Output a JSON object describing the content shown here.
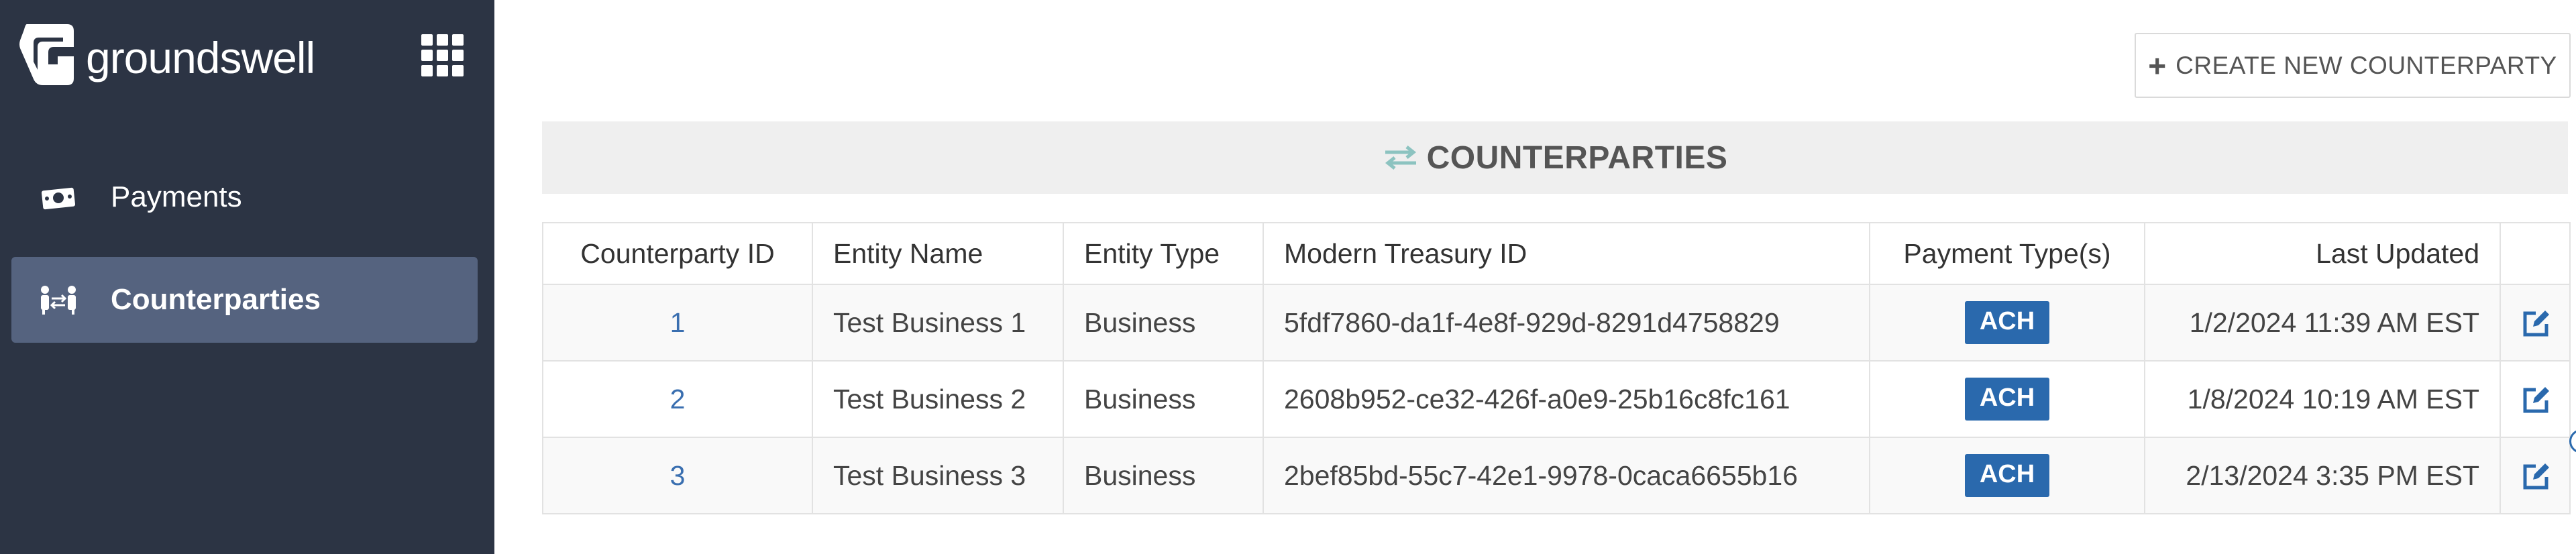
{
  "brand": {
    "name": "groundswell",
    "logo_icon": "groundswell-logo-icon",
    "apps_icon": "grid-apps-icon"
  },
  "nav": [
    {
      "label": "Payments",
      "icon": "money-icon",
      "active": false
    },
    {
      "label": "Counterparties",
      "icon": "people-exchange-icon",
      "active": true
    }
  ],
  "actions": {
    "create_label": "CREATE NEW COUNTERPARTY",
    "create_icon": "plus-icon"
  },
  "panel": {
    "title": "COUNTERPARTIES",
    "icon": "swap-arrows-icon"
  },
  "table": {
    "columns": [
      "Counterparty ID",
      "Entity Name",
      "Entity Type",
      "Modern Treasury ID",
      "Payment Type(s)",
      "Last Updated",
      ""
    ],
    "rows": [
      {
        "id": "1",
        "name": "Test Business 1",
        "type": "Business",
        "mt_id": "5fdf7860-da1f-4e8f-929d-8291d4758829",
        "payment": "ACH",
        "updated": "1/2/2024 11:39 AM EST"
      },
      {
        "id": "2",
        "name": "Test Business 2",
        "type": "Business",
        "mt_id": "2608b952-ce32-426f-a0e9-25b16c8fc161",
        "payment": "ACH",
        "updated": "1/8/2024 10:19 AM EST"
      },
      {
        "id": "3",
        "name": "Test Business 3",
        "type": "Business",
        "mt_id": "2bef85bd-55c7-42e1-9978-0caca6655b16",
        "payment": "ACH",
        "updated": "2/13/2024 3:35 PM EST"
      }
    ]
  },
  "colors": {
    "sidebar": "#2c3444",
    "nav_active": "#55637f",
    "accent": "#2a69ad",
    "header_bg": "#efefef",
    "swap_icon": "#8cc3c0"
  }
}
